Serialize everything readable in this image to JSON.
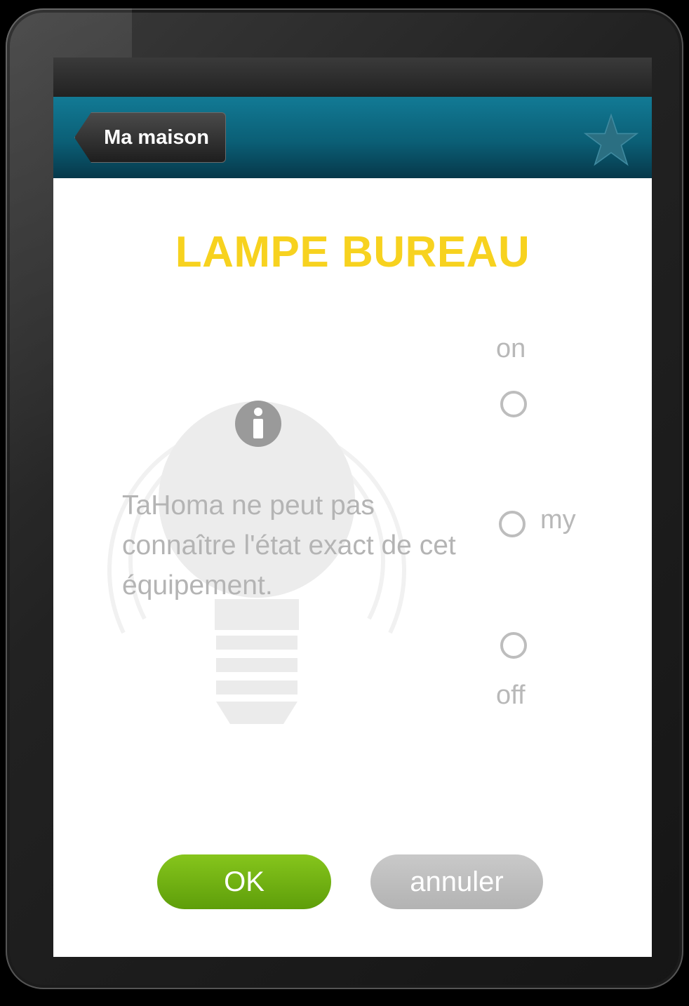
{
  "navbar": {
    "back_label": "Ma maison",
    "favorite_icon": "star-icon"
  },
  "device": {
    "name": "LAMPE BUREAU",
    "info_icon": "info-icon",
    "info_message": "TaHoma ne peut pas connaître l'état exact de cet équipement."
  },
  "states": {
    "on_label": "on",
    "my_label": "my",
    "off_label": "off"
  },
  "actions": {
    "ok_label": "OK",
    "cancel_label": "annuler"
  },
  "colors": {
    "title": "#f7d21f",
    "navbar": "#0b5f76",
    "ok_button": "#6fb312",
    "cancel_button": "#bdbdbd"
  }
}
